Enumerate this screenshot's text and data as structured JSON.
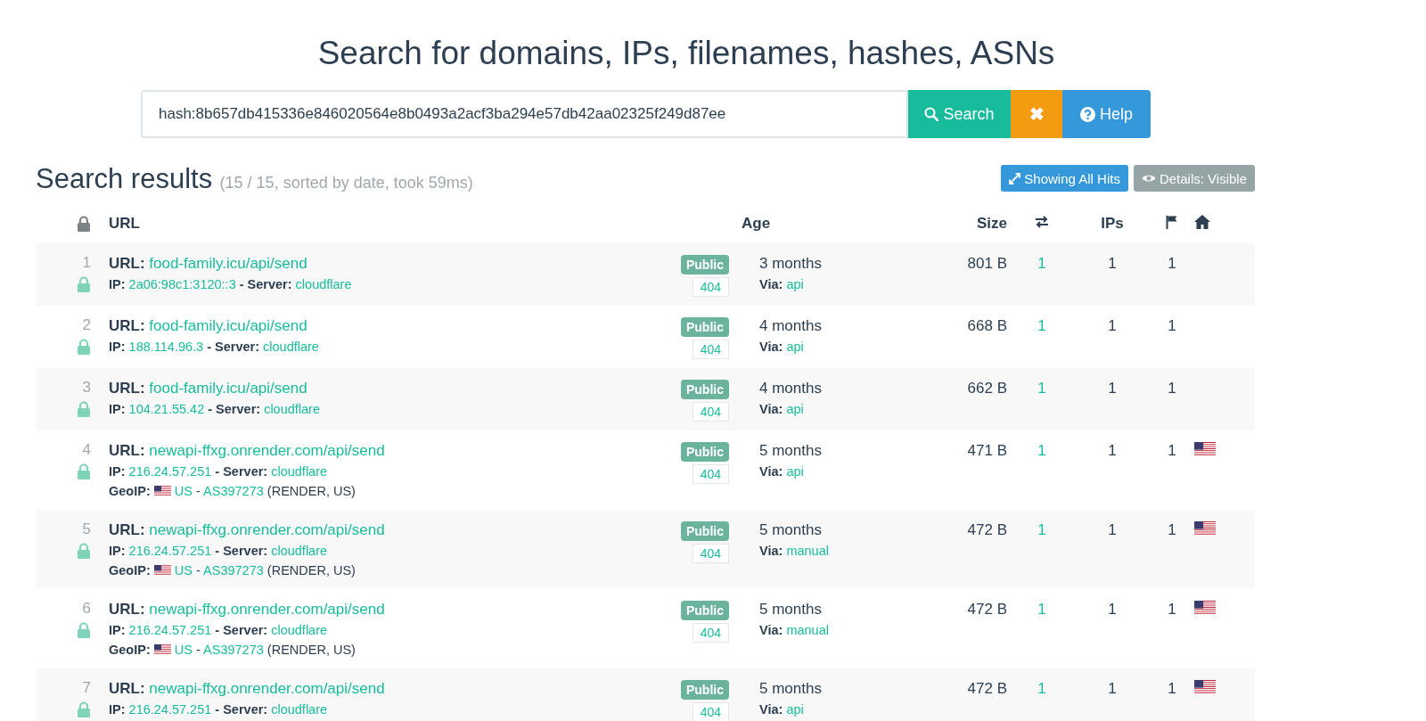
{
  "title": "Search for domains, IPs, filenames, hashes, ASNs",
  "search": {
    "value": "hash:8b657db415336e846020564e8b0493a2acf3ba294e57db42aa02325f249d87ee",
    "buttons": [
      {
        "kind": "search",
        "label": "Search"
      },
      {
        "kind": "clear",
        "label": "✖"
      },
      {
        "kind": "help",
        "label": "Help"
      }
    ]
  },
  "results": {
    "heading": "Search results",
    "summary": "(15 / 15, sorted by date, took 59ms)",
    "toggles": [
      {
        "kind": "hits",
        "label": "Showing All Hits"
      },
      {
        "kind": "details",
        "label": "Details: Visible"
      }
    ]
  },
  "table": {
    "columns": [
      {
        "kind": "lock"
      },
      {
        "kind": "text",
        "label": "URL"
      },
      {
        "kind": "text",
        "label": "Age"
      },
      {
        "kind": "text",
        "label": "Size"
      },
      {
        "kind": "links"
      },
      {
        "kind": "text",
        "label": "IPs"
      },
      {
        "kind": "flag"
      },
      {
        "kind": "home"
      }
    ],
    "rows": [
      {
        "index": "1",
        "url_label": "URL:",
        "url": "food-family.icu/api/send",
        "ip_label": "IP:",
        "ip": "2a06:98c1:3120::3",
        "server_label": "- Server:",
        "server": "cloudflare",
        "visibility": "Public",
        "status": "404",
        "age": "3 months",
        "via_label": "Via:",
        "via": "api",
        "size": "801 B",
        "links": "1",
        "ips": "1",
        "flags": "1",
        "home_flag": false
      },
      {
        "index": "2",
        "url_label": "URL:",
        "url": "food-family.icu/api/send",
        "ip_label": "IP:",
        "ip": "188.114.96.3",
        "server_label": "- Server:",
        "server": "cloudflare",
        "visibility": "Public",
        "status": "404",
        "age": "4 months",
        "via_label": "Via:",
        "via": "api",
        "size": "668 B",
        "links": "1",
        "ips": "1",
        "flags": "1",
        "home_flag": false
      },
      {
        "index": "3",
        "url_label": "URL:",
        "url": "food-family.icu/api/send",
        "ip_label": "IP:",
        "ip": "104.21.55.42",
        "server_label": "- Server:",
        "server": "cloudflare",
        "visibility": "Public",
        "status": "404",
        "age": "4 months",
        "via_label": "Via:",
        "via": "api",
        "size": "662 B",
        "links": "1",
        "ips": "1",
        "flags": "1",
        "home_flag": false
      },
      {
        "index": "4",
        "url_label": "URL:",
        "url": "newapi-ffxg.onrender.com/api/send",
        "ip_label": "IP:",
        "ip": "216.24.57.251",
        "server_label": "- Server:",
        "server": "cloudflare",
        "geoip": {
          "label": "GeoIP:",
          "country": "US",
          "separator": "-",
          "asn": "AS397273",
          "asn_name": "(RENDER, US)"
        },
        "visibility": "Public",
        "status": "404",
        "age": "5 months",
        "via_label": "Via:",
        "via": "api",
        "size": "471 B",
        "links": "1",
        "ips": "1",
        "flags": "1",
        "home_flag": true
      },
      {
        "index": "5",
        "url_label": "URL:",
        "url": "newapi-ffxg.onrender.com/api/send",
        "ip_label": "IP:",
        "ip": "216.24.57.251",
        "server_label": "- Server:",
        "server": "cloudflare",
        "geoip": {
          "label": "GeoIP:",
          "country": "US",
          "separator": "-",
          "asn": "AS397273",
          "asn_name": "(RENDER, US)"
        },
        "visibility": "Public",
        "status": "404",
        "age": "5 months",
        "via_label": "Via:",
        "via": "manual",
        "size": "472 B",
        "links": "1",
        "ips": "1",
        "flags": "1",
        "home_flag": true
      },
      {
        "index": "6",
        "url_label": "URL:",
        "url": "newapi-ffxg.onrender.com/api/send",
        "ip_label": "IP:",
        "ip": "216.24.57.251",
        "server_label": "- Server:",
        "server": "cloudflare",
        "geoip": {
          "label": "GeoIP:",
          "country": "US",
          "separator": "-",
          "asn": "AS397273",
          "asn_name": "(RENDER, US)"
        },
        "visibility": "Public",
        "status": "404",
        "age": "5 months",
        "via_label": "Via:",
        "via": "manual",
        "size": "472 B",
        "links": "1",
        "ips": "1",
        "flags": "1",
        "home_flag": true
      },
      {
        "index": "7",
        "url_label": "URL:",
        "url": "newapi-ffxg.onrender.com/api/send",
        "ip_label": "IP:",
        "ip": "216.24.57.251",
        "server_label": "- Server:",
        "server": "cloudflare",
        "visibility": "Public",
        "status": "404",
        "age": "5 months",
        "via_label": "Via:",
        "via": "api",
        "size": "472 B",
        "links": "1",
        "ips": "1",
        "flags": "1",
        "home_flag": true
      }
    ]
  }
}
